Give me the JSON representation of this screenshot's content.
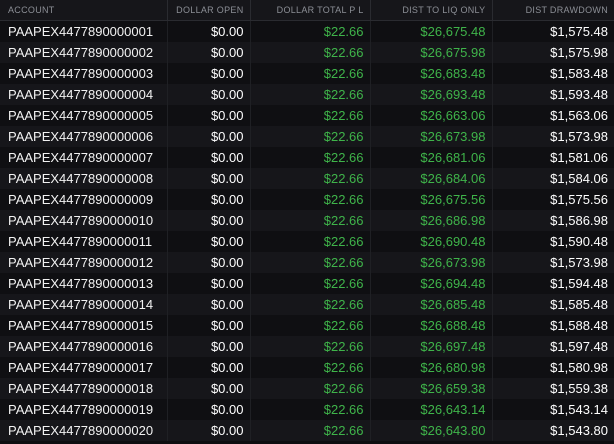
{
  "colors": {
    "positive": "#3fb44a",
    "neutral": "#ffffff",
    "header_text": "#8c8f96",
    "background": "#0e0e10"
  },
  "table": {
    "columns": [
      {
        "key": "account",
        "label": "ACCOUNT"
      },
      {
        "key": "dollar_open",
        "label": "DOLLAR OPEN"
      },
      {
        "key": "dollar_total_pl",
        "label": "DOLLAR TOTAL P L"
      },
      {
        "key": "dist_to_liq_only",
        "label": "DIST TO LIQ ONLY"
      },
      {
        "key": "dist_drawdown",
        "label": "DIST DRAWDOWN"
      }
    ],
    "rows": [
      {
        "account": "PAAPEX4477890000001",
        "dollar_open": "$0.00",
        "dollar_total_pl": "$22.66",
        "dist_to_liq_only": "$26,675.48",
        "dist_drawdown": "$1,575.48"
      },
      {
        "account": "PAAPEX4477890000002",
        "dollar_open": "$0.00",
        "dollar_total_pl": "$22.66",
        "dist_to_liq_only": "$26,675.98",
        "dist_drawdown": "$1,575.98"
      },
      {
        "account": "PAAPEX4477890000003",
        "dollar_open": "$0.00",
        "dollar_total_pl": "$22.66",
        "dist_to_liq_only": "$26,683.48",
        "dist_drawdown": "$1,583.48"
      },
      {
        "account": "PAAPEX4477890000004",
        "dollar_open": "$0.00",
        "dollar_total_pl": "$22.66",
        "dist_to_liq_only": "$26,693.48",
        "dist_drawdown": "$1,593.48"
      },
      {
        "account": "PAAPEX4477890000005",
        "dollar_open": "$0.00",
        "dollar_total_pl": "$22.66",
        "dist_to_liq_only": "$26,663.06",
        "dist_drawdown": "$1,563.06"
      },
      {
        "account": "PAAPEX4477890000006",
        "dollar_open": "$0.00",
        "dollar_total_pl": "$22.66",
        "dist_to_liq_only": "$26,673.98",
        "dist_drawdown": "$1,573.98"
      },
      {
        "account": "PAAPEX4477890000007",
        "dollar_open": "$0.00",
        "dollar_total_pl": "$22.66",
        "dist_to_liq_only": "$26,681.06",
        "dist_drawdown": "$1,581.06"
      },
      {
        "account": "PAAPEX4477890000008",
        "dollar_open": "$0.00",
        "dollar_total_pl": "$22.66",
        "dist_to_liq_only": "$26,684.06",
        "dist_drawdown": "$1,584.06"
      },
      {
        "account": "PAAPEX4477890000009",
        "dollar_open": "$0.00",
        "dollar_total_pl": "$22.66",
        "dist_to_liq_only": "$26,675.56",
        "dist_drawdown": "$1,575.56"
      },
      {
        "account": "PAAPEX4477890000010",
        "dollar_open": "$0.00",
        "dollar_total_pl": "$22.66",
        "dist_to_liq_only": "$26,686.98",
        "dist_drawdown": "$1,586.98"
      },
      {
        "account": "PAAPEX4477890000011",
        "dollar_open": "$0.00",
        "dollar_total_pl": "$22.66",
        "dist_to_liq_only": "$26,690.48",
        "dist_drawdown": "$1,590.48"
      },
      {
        "account": "PAAPEX4477890000012",
        "dollar_open": "$0.00",
        "dollar_total_pl": "$22.66",
        "dist_to_liq_only": "$26,673.98",
        "dist_drawdown": "$1,573.98"
      },
      {
        "account": "PAAPEX4477890000013",
        "dollar_open": "$0.00",
        "dollar_total_pl": "$22.66",
        "dist_to_liq_only": "$26,694.48",
        "dist_drawdown": "$1,594.48"
      },
      {
        "account": "PAAPEX4477890000014",
        "dollar_open": "$0.00",
        "dollar_total_pl": "$22.66",
        "dist_to_liq_only": "$26,685.48",
        "dist_drawdown": "$1,585.48"
      },
      {
        "account": "PAAPEX4477890000015",
        "dollar_open": "$0.00",
        "dollar_total_pl": "$22.66",
        "dist_to_liq_only": "$26,688.48",
        "dist_drawdown": "$1,588.48"
      },
      {
        "account": "PAAPEX4477890000016",
        "dollar_open": "$0.00",
        "dollar_total_pl": "$22.66",
        "dist_to_liq_only": "$26,697.48",
        "dist_drawdown": "$1,597.48"
      },
      {
        "account": "PAAPEX4477890000017",
        "dollar_open": "$0.00",
        "dollar_total_pl": "$22.66",
        "dist_to_liq_only": "$26,680.98",
        "dist_drawdown": "$1,580.98"
      },
      {
        "account": "PAAPEX4477890000018",
        "dollar_open": "$0.00",
        "dollar_total_pl": "$22.66",
        "dist_to_liq_only": "$26,659.38",
        "dist_drawdown": "$1,559.38"
      },
      {
        "account": "PAAPEX4477890000019",
        "dollar_open": "$0.00",
        "dollar_total_pl": "$22.66",
        "dist_to_liq_only": "$26,643.14",
        "dist_drawdown": "$1,543.14"
      },
      {
        "account": "PAAPEX4477890000020",
        "dollar_open": "$0.00",
        "dollar_total_pl": "$22.66",
        "dist_to_liq_only": "$26,643.80",
        "dist_drawdown": "$1,543.80"
      }
    ]
  }
}
